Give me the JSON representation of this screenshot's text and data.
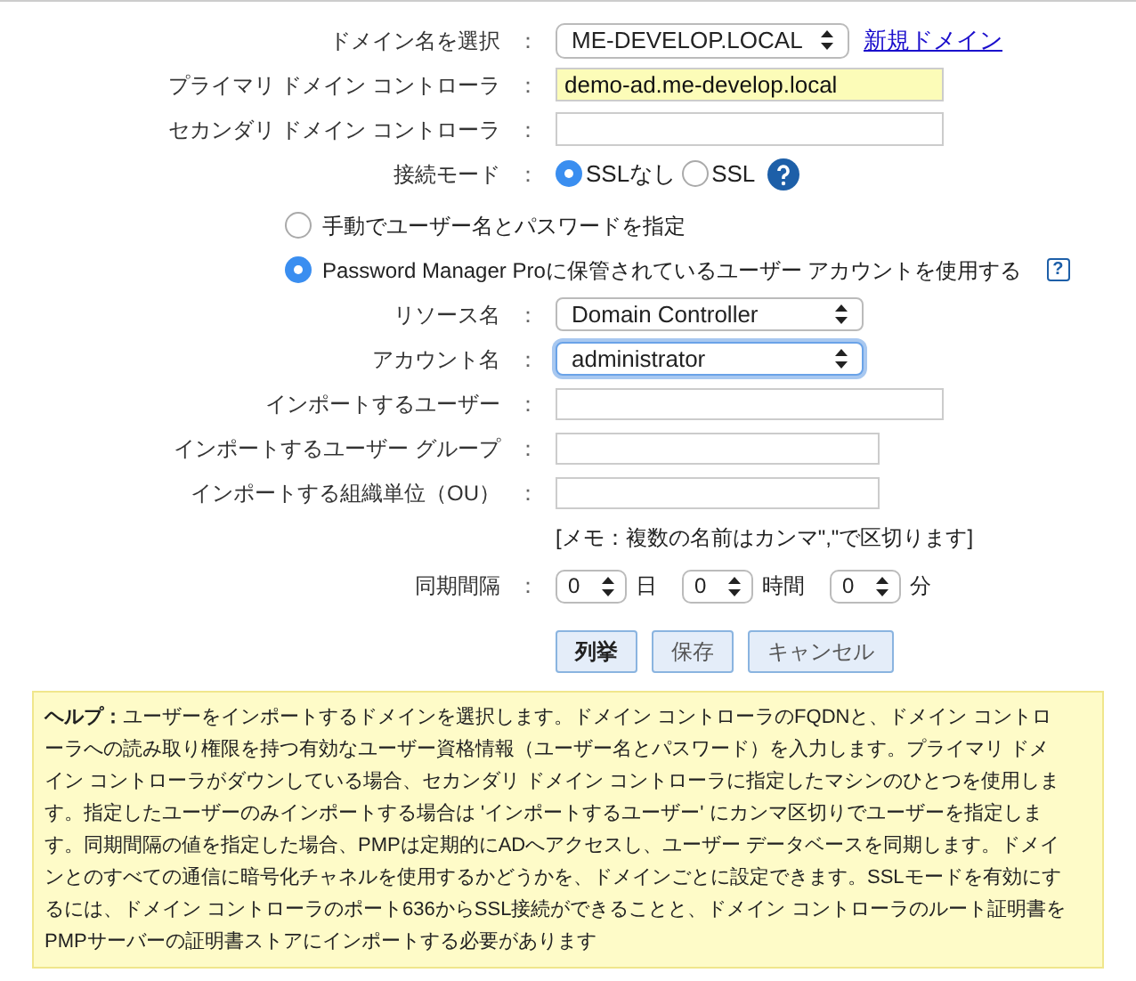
{
  "domain": {
    "label": "ドメイン名を選択",
    "colon": "：",
    "value": "ME-DEVELOP.LOCAL",
    "link": "新規ドメイン"
  },
  "fields": [
    {
      "label": "プライマリ ドメイン コントローラ",
      "colon": "：",
      "value": "demo-ad.me-develop.local",
      "autofilled": true
    },
    {
      "label": "セカンダリ ドメイン コントローラ",
      "colon": "：",
      "autofilled": false
    }
  ],
  "connection_mode": {
    "label": "接続モード",
    "colon": "：",
    "options": [
      {
        "label": "SSLなし",
        "selected": true
      },
      {
        "label": "SSL",
        "selected": false
      }
    ]
  },
  "auth_options": [
    {
      "label": "手動でユーザー名とパスワードを指定",
      "selected": false
    },
    {
      "label": "Password Manager Proに保管されているユーザー アカウントを使用する",
      "selected": true,
      "help_glyph": "?"
    }
  ],
  "selects": [
    {
      "label": "リソース名",
      "colon": "：",
      "value": "Domain Controller",
      "focused": false
    },
    {
      "label": "アカウント名",
      "colon": "：",
      "value": "administrator",
      "focused": true
    }
  ],
  "import_fields": [
    {
      "label": "インポートするユーザー",
      "colon": "：",
      "wide": true
    },
    {
      "label": "インポートするユーザー グループ",
      "colon": "：",
      "wide": false
    },
    {
      "label": "インポートする組織単位（OU）",
      "colon": "：",
      "wide": false
    }
  ],
  "memo": "[メモ：複数の名前はカンマ\",\"で区切ります]",
  "sync": {
    "label": "同期間隔",
    "colon": "：",
    "units": [
      {
        "value": "0",
        "unit": "日"
      },
      {
        "value": "0",
        "unit": "時間"
      },
      {
        "value": "0",
        "unit": "分"
      }
    ]
  },
  "buttons": [
    {
      "label": "列挙",
      "primary": true
    },
    {
      "label": "保存",
      "primary": false
    },
    {
      "label": "キャンセル",
      "primary": false
    }
  ],
  "help": "**ヘルプ：**ユーザーをインポートするドメインを選択します。ドメイン コントローラのFQDNと、ドメイン コントローラへの読み取り権限を持つ有効なユーザー資格情報（ユーザー名とパスワード）を入力します。プライマリ ドメイン コントローラがダウンしている場合、セカンダリ ドメイン コントローラに指定したマシンのひとつを使用します。指定したユーザーのみインポートする場合は 'インポートするユーザー' にカンマ区切りでユーザーを指定します。同期間隔の値を指定した場合、PMPは定期的にADへアクセスし、ユーザー データベースを同期します。ドメインとのすべての通信に暗号化チャネルを使用するかどうかを、ドメインごとに設定できます。SSLモードを有効にするには、ドメイン コントローラのポート636からSSL接続ができることと、ドメイン コントローラのルート証明書をPMPサーバーの証明書ストアにインポートする必要があります"
}
